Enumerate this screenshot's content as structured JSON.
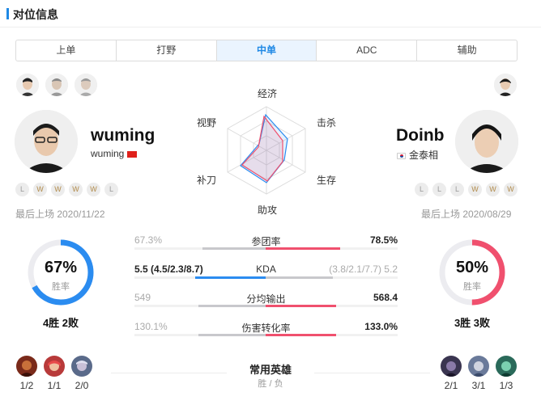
{
  "header": {
    "title": "对位信息"
  },
  "tabs": [
    {
      "label": "上单",
      "active": false
    },
    {
      "label": "打野",
      "active": false
    },
    {
      "label": "中单",
      "active": true
    },
    {
      "label": "ADC",
      "active": false
    },
    {
      "label": "辅助",
      "active": false
    }
  ],
  "radar": {
    "labels": [
      "经济",
      "击杀",
      "生存",
      "助攻",
      "补刀",
      "视野"
    ],
    "left_color": "#2b8cf0",
    "right_color": "#f0506e"
  },
  "left_player": {
    "name": "wuming",
    "real_name": "wuming",
    "recent_results": [
      "L",
      "W",
      "W",
      "W",
      "W",
      "L"
    ],
    "last_played": "最后上场 2020/11/22",
    "win_rate": "67%",
    "win_rate_value": 0.67,
    "win_rate_caption": "胜率",
    "record": "4胜 2败",
    "ring_color": "#2b8cf0"
  },
  "right_player": {
    "name": "Doinb",
    "real_name": "金泰相",
    "recent_results": [
      "L",
      "L",
      "L",
      "W",
      "W",
      "W"
    ],
    "last_played": "最后上场 2020/08/29",
    "win_rate": "50%",
    "win_rate_value": 0.5,
    "win_rate_caption": "胜率",
    "record": "3胜 3败",
    "ring_color": "#f0506e"
  },
  "stats": [
    {
      "label": "参团率",
      "left": "67.3%",
      "right": "78.5%",
      "left_dim": true,
      "right_dim": false,
      "left_share": 0.46,
      "right_share": 0.54
    },
    {
      "label": "KDA",
      "left": "5.5 (4.5/2.3/8.7)",
      "right": "(3.8/2.1/7.7) 5.2",
      "left_dim": false,
      "right_dim": true,
      "left_share": 0.51,
      "right_share": 0.49
    },
    {
      "label": "分均输出",
      "left": "549",
      "right": "568.4",
      "left_dim": true,
      "right_dim": false,
      "left_share": 0.49,
      "right_share": 0.51
    },
    {
      "label": "伤害转化率",
      "left": "130.1%",
      "right": "133.0%",
      "left_dim": true,
      "right_dim": false,
      "left_share": 0.49,
      "right_share": 0.51
    }
  ],
  "common_heroes": {
    "title": "常用英雄",
    "subtitle": "胜 / 负",
    "left": [
      {
        "score": "1/2",
        "color": "#7a2a1a"
      },
      {
        "score": "1/1",
        "color": "#b83a3a"
      },
      {
        "score": "2/0",
        "color": "#5a6a8a"
      }
    ],
    "right": [
      {
        "score": "2/1",
        "color": "#3a3550"
      },
      {
        "score": "3/1",
        "color": "#6a7a9a"
      },
      {
        "score": "1/3",
        "color": "#2a6a5a"
      }
    ]
  }
}
